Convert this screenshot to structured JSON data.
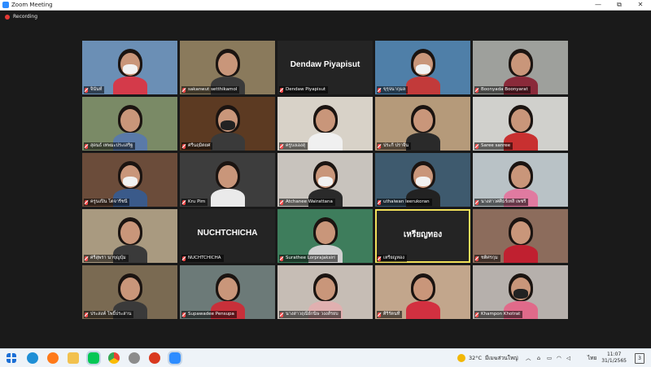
{
  "window": {
    "title": "Zoom Meeting",
    "minimize": "—",
    "maximize": "⧉",
    "close": "✕"
  },
  "recording": {
    "label": "Recording"
  },
  "participants": [
    {
      "name": "จินันท์",
      "bg": "#6b8fb5"
    },
    {
      "name": "sakanwut setthikamol",
      "bg": "#8a7a5c"
    },
    {
      "name": "Dendaw Piyapisut",
      "bg": "#242424",
      "display": "Dendaw Piyapisut"
    },
    {
      "name": "ขุรุจนากุมล",
      "bg": "#4f7fa8"
    },
    {
      "name": "Boonyada Boonyarat",
      "bg": "#9ea09c"
    },
    {
      "name": "สุดนธ์ เทพมะประเสริฐ",
      "bg": "#7a8a66"
    },
    {
      "name": "ศรีนฤมิตยศ",
      "bg": "#5c3a22"
    },
    {
      "name": "ครูบงเองสุ",
      "bg": "#d8d2c8"
    },
    {
      "name": "ประกี ปราจีน",
      "bg": "#b59a7a"
    },
    {
      "name": "Saree sanree",
      "bg": "#d0d0cc"
    },
    {
      "name": "ครูนงปิน โตจารีชนี",
      "bg": "#6b4c3a"
    },
    {
      "name": "Kru Pim",
      "bg": "#3d3d3d"
    },
    {
      "name": "Atchanee Wairattana",
      "bg": "#c8c3bd"
    },
    {
      "name": "uthaiwan leerukoran",
      "bg": "#3e5a6e"
    },
    {
      "name": "นางสาวศศิธร์เทสิ เพชรี",
      "bg": "#b9c2c6"
    },
    {
      "name": "ศรีสุพรา นาขุญบุ้ม",
      "bg": "#a99a80"
    },
    {
      "name": "NUCHTCHICHA",
      "bg": "#242424",
      "display": "NUCHTCHICHA"
    },
    {
      "name": "Surathee Lorprajaksiri",
      "bg": "#3e7d5c"
    },
    {
      "name": "เหรียญทอง",
      "bg": "#242424",
      "display": "เหรียญทอง"
    },
    {
      "name": "ชติศรกุม",
      "bg": "#8c6c5c"
    },
    {
      "name": "ประสงค์ โพธิ์ประสาน",
      "bg": "#7a6a52"
    },
    {
      "name": "Supawadee Pensupa",
      "bg": "#6c7a78"
    },
    {
      "name": "นางสาวฤณีย์กนิษ วงงส์รยบ",
      "bg": "#c6bdb5"
    },
    {
      "name": "ศิริรัตนที",
      "bg": "#c2a68c"
    },
    {
      "name": "Khampon Khotrat",
      "bg": "#b6b0ac"
    }
  ],
  "taskbar": {
    "weather": "32°C",
    "weather_desc": "มีเมฆส่วนใหญ่",
    "lang": "ไทย",
    "time": "11:07",
    "date": "31/1/2565",
    "notifications": "3"
  }
}
